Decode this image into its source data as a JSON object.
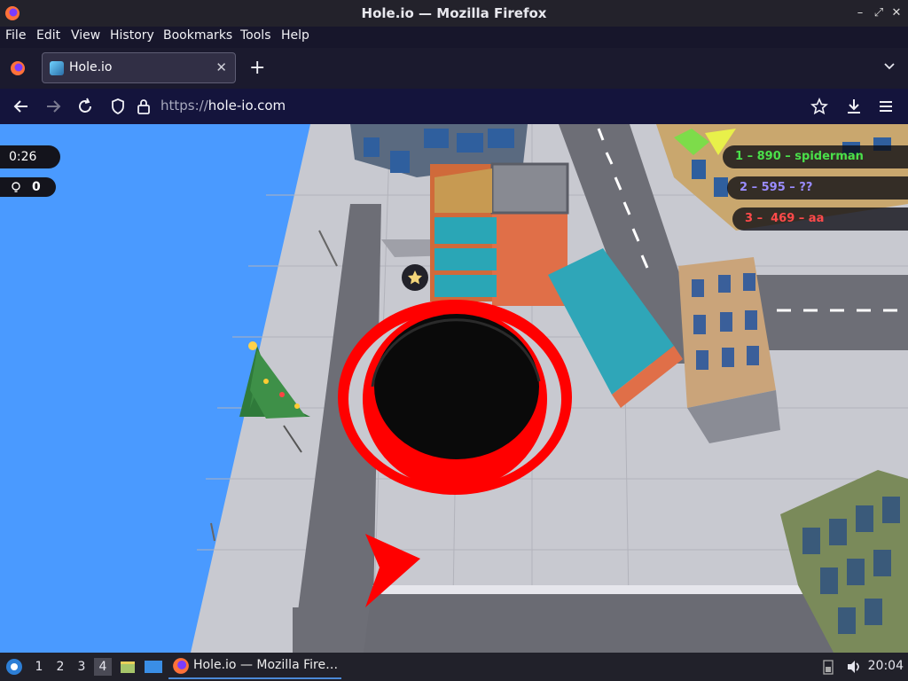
{
  "window": {
    "title": "Hole.io — Mozilla Firefox"
  },
  "menu": [
    "File",
    "Edit",
    "View",
    "History",
    "Bookmarks",
    "Tools",
    "Help"
  ],
  "tab": {
    "title": "Hole.io"
  },
  "url": {
    "scheme": "https://",
    "host": "hole-io.com"
  },
  "hud": {
    "timer": "0:26",
    "score": "0"
  },
  "leaderboard": [
    {
      "text": "1 – 890 – spiderman",
      "color": "#4ae04a"
    },
    {
      "text": "2 – 595 – ??",
      "color": "#9a8cff"
    },
    {
      "text": "3 –  469 – aa",
      "color": "#ff4a4a"
    }
  ],
  "taskbar": {
    "workspaces": [
      "1",
      "2",
      "3",
      "4"
    ],
    "active_workspace": "4",
    "window_label": "Hole.io — Mozilla Fire…",
    "clock": "20:04"
  },
  "icons": {
    "firefox": "firefox-icon",
    "back": "back-arrow-icon",
    "forward": "forward-arrow-icon",
    "reload": "reload-icon",
    "shield": "shield-icon",
    "lock": "lock-icon",
    "bookmark": "star-icon",
    "download": "download-icon",
    "menu": "hamburger-menu-icon"
  }
}
